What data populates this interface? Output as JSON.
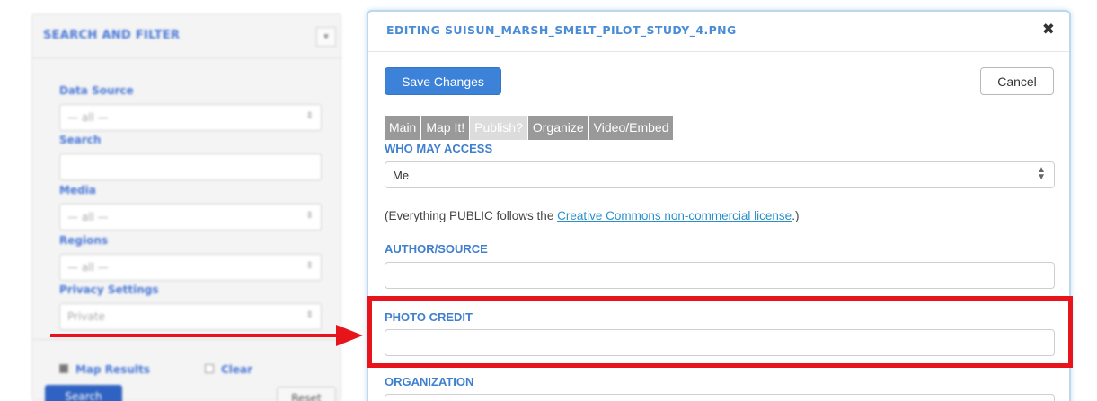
{
  "sidebar": {
    "title": "SEARCH AND FILTER",
    "collapse_icon": "▾",
    "fields": [
      {
        "label": "Data Source",
        "value": "— all —"
      },
      {
        "label": "Search",
        "value": ""
      },
      {
        "label": "Media",
        "value": "— all —"
      },
      {
        "label": "Regions",
        "value": "— all —"
      },
      {
        "label": "Privacy Settings",
        "value": "Private"
      }
    ],
    "map_results": "Map Results",
    "clear": "Clear",
    "search_button": "Search",
    "reset_button": "Reset"
  },
  "modal": {
    "title": "EDITING SUISUN_MARSH_SMELT_PILOT_STUDY_4.PNG",
    "close_icon": "✖",
    "save_label": "Save Changes",
    "cancel_label": "Cancel",
    "tabs": [
      {
        "label": "Main",
        "active": false
      },
      {
        "label": "Map It!",
        "active": false
      },
      {
        "label": "Publish?",
        "active": true
      },
      {
        "label": "Organize",
        "active": false
      },
      {
        "label": "Video/Embed",
        "active": false
      }
    ],
    "who_may_access": {
      "label": "WHO MAY ACCESS",
      "value": "Me"
    },
    "license_note": {
      "prefix": "(Everything PUBLIC follows the ",
      "link": "Creative Commons non-commercial license",
      "suffix": ".)"
    },
    "author_source": {
      "label": "AUTHOR/SOURCE",
      "value": ""
    },
    "photo_credit": {
      "label": "PHOTO CREDIT",
      "value": ""
    },
    "organization": {
      "label": "ORGANIZATION",
      "value": ""
    }
  },
  "colors": {
    "accent": "#3c82d9",
    "label_blue": "#3f7fcf",
    "annotation_red": "#e8141b",
    "tab_gray": "#999999"
  }
}
